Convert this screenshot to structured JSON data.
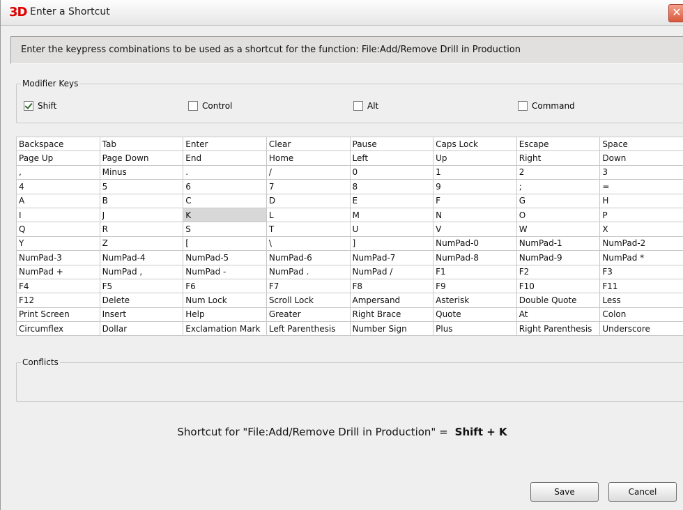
{
  "window": {
    "app_logo": "3D",
    "title": "Enter a Shortcut",
    "close_glyph": "✕"
  },
  "prompt": "Enter the keypress combinations to be used as a shortcut for the function: File:Add/Remove Drill in Production",
  "modifiers": {
    "legend": "Modifier Keys",
    "items": [
      {
        "label": "Shift",
        "checked": true
      },
      {
        "label": "Control",
        "checked": false
      },
      {
        "label": "Alt",
        "checked": false
      },
      {
        "label": "Command",
        "checked": false
      }
    ]
  },
  "keys": {
    "selected": "K",
    "rows": [
      [
        "Backspace",
        "Tab",
        "Enter",
        "Clear",
        "Pause",
        "Caps Lock",
        "Escape",
        "Space"
      ],
      [
        "Page Up",
        "Page Down",
        "End",
        "Home",
        "Left",
        "Up",
        "Right",
        "Down"
      ],
      [
        ",",
        "Minus",
        ".",
        "/",
        "0",
        "1",
        "2",
        "3"
      ],
      [
        "4",
        "5",
        "6",
        "7",
        "8",
        "9",
        ";",
        "="
      ],
      [
        "A",
        "B",
        "C",
        "D",
        "E",
        "F",
        "G",
        "H"
      ],
      [
        "I",
        "J",
        "K",
        "L",
        "M",
        "N",
        "O",
        "P"
      ],
      [
        "Q",
        "R",
        "S",
        "T",
        "U",
        "V",
        "W",
        "X"
      ],
      [
        "Y",
        "Z",
        "[",
        "\\",
        "]",
        "NumPad-0",
        "NumPad-1",
        "NumPad-2"
      ],
      [
        "NumPad-3",
        "NumPad-4",
        "NumPad-5",
        "NumPad-6",
        "NumPad-7",
        "NumPad-8",
        "NumPad-9",
        "NumPad *"
      ],
      [
        "NumPad +",
        "NumPad ,",
        "NumPad -",
        "NumPad .",
        "NumPad /",
        "F1",
        "F2",
        "F3"
      ],
      [
        "F4",
        "F5",
        "F6",
        "F7",
        "F8",
        "F9",
        "F10",
        "F11"
      ],
      [
        "F12",
        "Delete",
        "Num Lock",
        "Scroll Lock",
        "Ampersand",
        "Asterisk",
        "Double Quote",
        "Less"
      ],
      [
        "Print Screen",
        "Insert",
        "Help",
        "Greater",
        "Right Brace",
        "Quote",
        "At",
        "Colon"
      ],
      [
        "Circumflex",
        "Dollar",
        "Exclamation Mark",
        "Left Parenthesis",
        "Number Sign",
        "Plus",
        "Right Parenthesis",
        "Underscore"
      ]
    ]
  },
  "conflicts": {
    "legend": "Conflicts"
  },
  "summary": {
    "text": "Shortcut for \"File:Add/Remove Drill in Production\" =",
    "combo": "Shift + K"
  },
  "buttons": {
    "save": "Save",
    "cancel": "Cancel"
  }
}
